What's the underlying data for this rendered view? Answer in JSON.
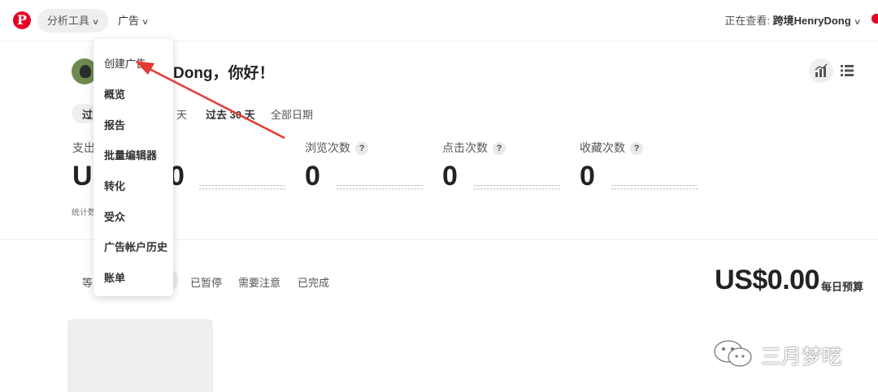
{
  "header": {
    "logo_letter": "P",
    "analytics_label": "分析工具",
    "ads_label": "广告",
    "viewing_prefix": "正在查看: ",
    "viewing_account": "跨境HenryDong"
  },
  "greeting": {
    "text": "Dong，你好！"
  },
  "date_range": {
    "active": "过",
    "items": [
      "天",
      "过去 30 天",
      "全部日期"
    ]
  },
  "metrics": {
    "spend_label": "支出",
    "spend_value_partial_left": "U",
    "spend_value_partial_right": "0",
    "impressions_label": "浏览次数",
    "impressions_value": "0",
    "clicks_label": "点击次数",
    "clicks_value": "0",
    "saves_label": "收藏次数",
    "saves_value": "0",
    "help_glyph": "?",
    "note_partial": "统计数"
  },
  "status_filters": {
    "first_partial": "等",
    "items": [
      "已暂停",
      "需要注意",
      "已完成"
    ]
  },
  "budget": {
    "amount": "US$0.00",
    "label": "每日预算"
  },
  "dropdown": {
    "items": [
      "创建广告",
      "概览",
      "报告",
      "批量编辑器",
      "转化",
      "受众",
      "广告帐户历史",
      "账单"
    ]
  },
  "watermark": {
    "text": "三月梦呓"
  },
  "colors": {
    "brand": "#e60023",
    "annotation_arrow": "#e53935",
    "pill_bg": "#efefef"
  }
}
